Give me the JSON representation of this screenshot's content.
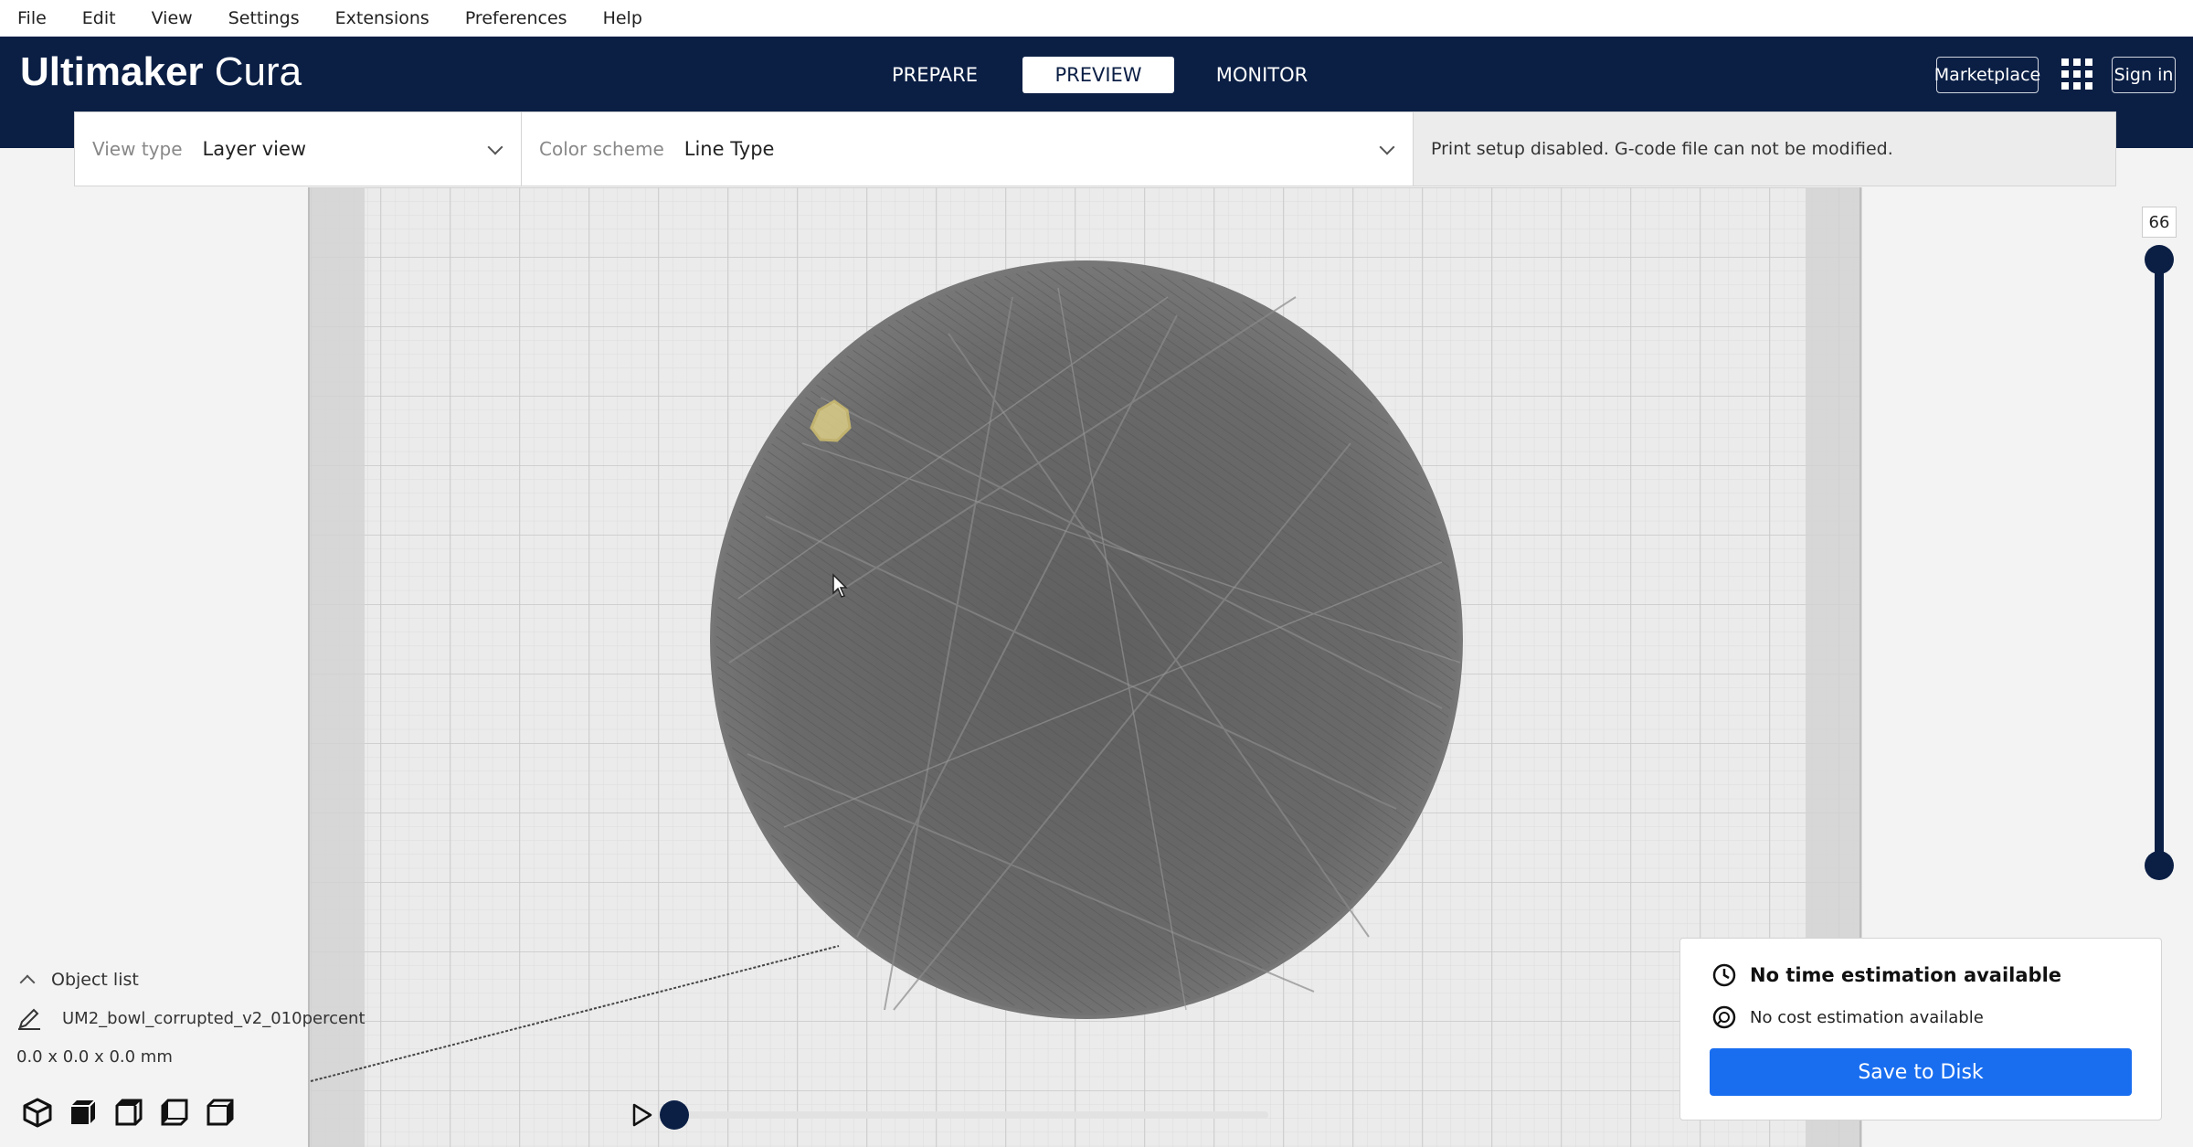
{
  "menu": [
    "File",
    "Edit",
    "View",
    "Settings",
    "Extensions",
    "Preferences",
    "Help"
  ],
  "app": {
    "logo_bold": "Ultimaker",
    "logo_light": "Cura"
  },
  "stages": [
    {
      "label": "PREPARE",
      "active": false
    },
    {
      "label": "PREVIEW",
      "active": true
    },
    {
      "label": "MONITOR",
      "active": false
    }
  ],
  "header": {
    "marketplace": "Marketplace",
    "signin": "Sign in"
  },
  "viewbar": {
    "view_type_label": "View type",
    "view_type_value": "Layer view",
    "color_scheme_label": "Color scheme",
    "color_scheme_value": "Line Type",
    "notice": "Print setup disabled. G-code file can not be modified."
  },
  "layer_slider": {
    "current_layer": "66"
  },
  "object_list": {
    "toggle_label": "Object list",
    "object_name": "UM2_bowl_corrupted_v2_010percent",
    "dimensions": "0.0 x 0.0 x 0.0 mm"
  },
  "estimation": {
    "time": "No time estimation available",
    "cost": "No cost estimation available",
    "save_button": "Save to Disk"
  },
  "colors": {
    "header_bg": "#0b1f45",
    "accent": "#196ef0",
    "model": "#6e6e6e"
  }
}
